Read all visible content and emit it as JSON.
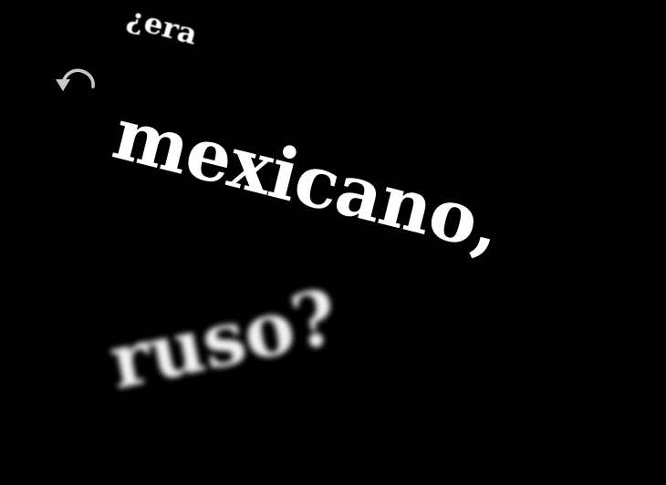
{
  "controls": {
    "undo_icon": "undo-icon",
    "icon_color": "#c8c8c8"
  },
  "words": {
    "w1": "¿era",
    "w2": "mexicano,",
    "w3": "ruso?"
  },
  "colors": {
    "background": "#000000",
    "text": "#ffffff"
  }
}
